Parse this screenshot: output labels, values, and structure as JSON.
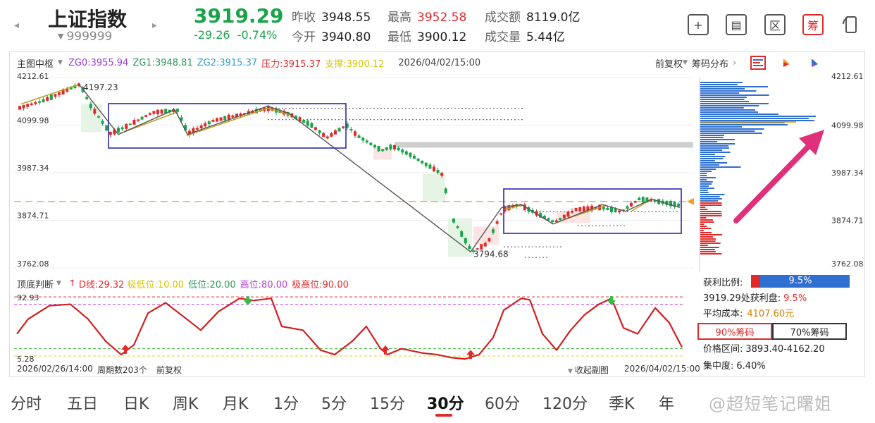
{
  "header": {
    "name": "上证指数",
    "code": "999999",
    "price": "3919.29",
    "change": "-29.26",
    "change_pct": "-0.74%",
    "quotes": [
      {
        "k": "昨收",
        "v": "3948.55",
        "red": false
      },
      {
        "k": "今开",
        "v": "3940.80",
        "red": false
      },
      {
        "k": "最高",
        "v": "3952.58",
        "red": true
      },
      {
        "k": "最低",
        "v": "3900.12",
        "red": false
      },
      {
        "k": "成交额",
        "v": "8119.0亿",
        "red": false
      },
      {
        "k": "成交量",
        "v": "5.44亿",
        "red": false
      }
    ],
    "tools": [
      {
        "name": "add-icon",
        "glyph": "+"
      },
      {
        "name": "panel-icon",
        "glyph": "▤"
      },
      {
        "name": "region-icon",
        "glyph": "区"
      },
      {
        "name": "chips-icon",
        "glyph": "筹"
      },
      {
        "name": "rotate-icon",
        "glyph": "⟳"
      }
    ]
  },
  "main_chart": {
    "indicator": "主图中枢",
    "zg0": "ZG0:3955.94",
    "zg1": "ZG1:3948.81",
    "zg2": "ZG2:3915.37",
    "pressure": "压力:3915.37",
    "support": "支撑:3900.12",
    "datetime": "2026/04/02/15:00",
    "adj": "前复权",
    "chip_dist": "筹码分布",
    "y_ticks": [
      "4212.61",
      "4099.98",
      "3987.34",
      "3874.71",
      "3762.08"
    ],
    "high_label": "4197.23",
    "low_label": "3794.68",
    "colors": {
      "up": "#e02a2a",
      "down": "#1aa34a",
      "box": "#2a2aa8"
    }
  },
  "chip_panel": {
    "profit_ratio_label": "获利比例:",
    "profit_ratio": "9.5%",
    "profit_fraction": 0.095,
    "at_price_label": "3919.29处获利盘:",
    "at_price_value": "9.5%",
    "avg_cost_label": "平均成本:",
    "avg_cost": "4107.60元",
    "btn_90": "90%筹码",
    "btn_70": "70%筹码",
    "range_label": "价格区间:",
    "range": "3893.40-4162.20",
    "concentration_label": "集中度:",
    "concentration": "6.40%",
    "y_ticks": [
      "4212.61",
      "4099.98",
      "3987.34",
      "3874.71",
      "3762.08"
    ]
  },
  "sub_chart": {
    "indicator": "顶底判断",
    "d_line": "D线:29.32",
    "extreme_low": "极低位:10.00",
    "low": "低位:20.00",
    "high": "高位:80.00",
    "extreme_high": "极高位:90.00",
    "top_value": "92.93",
    "bottom_value": "5.28",
    "start_time": "2026/02/26/14:00",
    "period_count": "周期数203个",
    "adj": "前复权",
    "collapse": "收起副图",
    "end_time": "2026/04/02/15:00"
  },
  "tabs": {
    "items": [
      "分时",
      "五日",
      "日K",
      "周K",
      "月K",
      "1分",
      "5分",
      "15分",
      "30分",
      "60分",
      "120分",
      "季K",
      "年"
    ],
    "selected": "30分"
  },
  "watermark": "@超短笔记曙姐"
}
